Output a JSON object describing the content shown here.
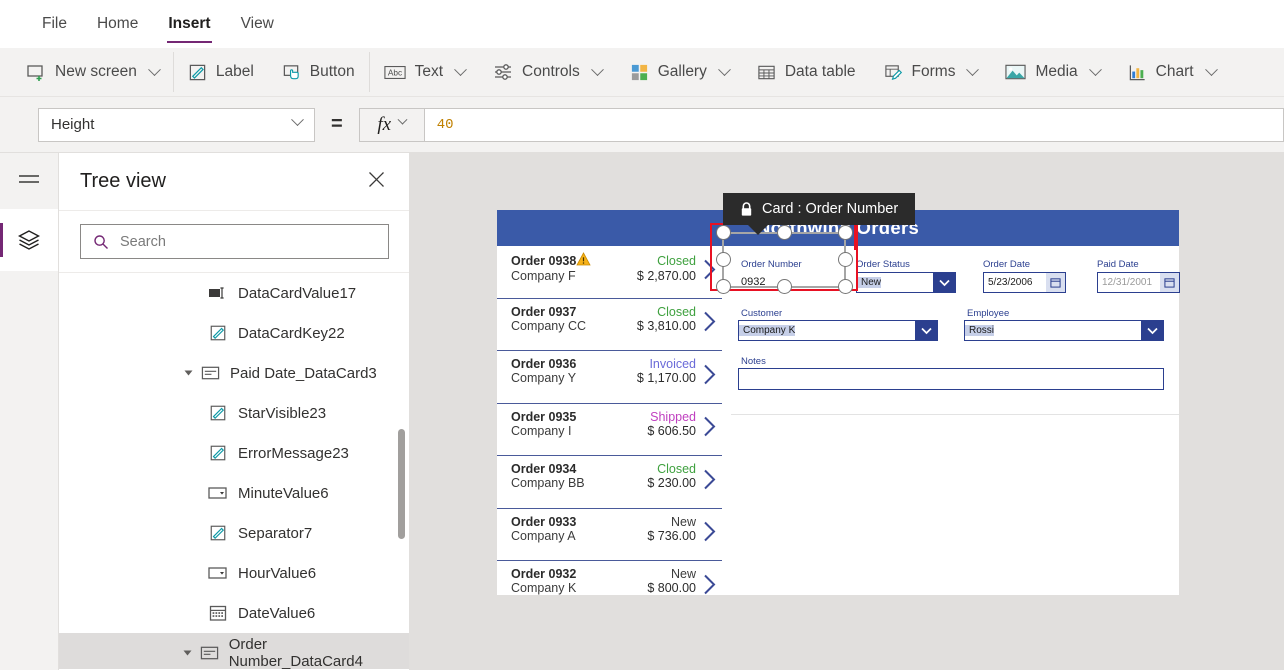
{
  "menu": {
    "items": [
      {
        "label": "File",
        "active": false
      },
      {
        "label": "Home",
        "active": false
      },
      {
        "label": "Insert",
        "active": true
      },
      {
        "label": "View",
        "active": false
      }
    ]
  },
  "ribbon": {
    "items": [
      {
        "label": "New screen",
        "icon": "new-screen-icon",
        "caret": true
      },
      {
        "label": "Label",
        "icon": "label-icon",
        "caret": false
      },
      {
        "label": "Button",
        "icon": "button-icon",
        "caret": false
      },
      {
        "label": "Text",
        "icon": "text-abc-icon",
        "caret": true
      },
      {
        "label": "Controls",
        "icon": "controls-sliders-icon",
        "caret": true
      },
      {
        "label": "Gallery",
        "icon": "gallery-squares-icon",
        "caret": true
      },
      {
        "label": "Data table",
        "icon": "data-table-icon",
        "caret": false
      },
      {
        "label": "Forms",
        "icon": "forms-icon",
        "caret": true
      },
      {
        "label": "Media",
        "icon": "media-image-icon",
        "caret": true
      },
      {
        "label": "Chart",
        "icon": "chart-bars-icon",
        "caret": true
      }
    ]
  },
  "property_bar": {
    "selected_property": "Height",
    "equals": "=",
    "fx_label": "fx",
    "formula_value": "40"
  },
  "tree_panel": {
    "title": "Tree view",
    "close_label": "✕",
    "search_placeholder": "Search",
    "search_value": "",
    "items": [
      {
        "label": "DataCardValue17",
        "icon": "text-input-icon",
        "indent": 3,
        "expander": false,
        "selected": false
      },
      {
        "label": "DataCardKey22",
        "icon": "label-pencil-icon",
        "indent": 3,
        "expander": false,
        "selected": false
      },
      {
        "label": "Paid Date_DataCard3",
        "icon": "datacard-icon",
        "indent": 2,
        "expander": true,
        "selected": false
      },
      {
        "label": "StarVisible23",
        "icon": "label-pencil-icon",
        "indent": 3,
        "expander": false,
        "selected": false
      },
      {
        "label": "ErrorMessage23",
        "icon": "label-pencil-icon",
        "indent": 3,
        "expander": false,
        "selected": false
      },
      {
        "label": "MinuteValue6",
        "icon": "dropdown-icon",
        "indent": 3,
        "expander": false,
        "selected": false
      },
      {
        "label": "Separator7",
        "icon": "label-pencil-icon",
        "indent": 3,
        "expander": false,
        "selected": false
      },
      {
        "label": "HourValue6",
        "icon": "dropdown-icon",
        "indent": 3,
        "expander": false,
        "selected": false
      },
      {
        "label": "DateValue6",
        "icon": "calendar-icon",
        "indent": 3,
        "expander": false,
        "selected": false
      },
      {
        "label": "Order Number_DataCard4",
        "icon": "datacard-icon",
        "indent": 2,
        "expander": true,
        "selected": true
      }
    ]
  },
  "canvas": {
    "app_title": "Northwind Orders",
    "tooltip": {
      "text": "Card : Order Number",
      "icon": "lock-icon"
    },
    "gallery": {
      "items": [
        {
          "order": "Order 0938",
          "company": "Company F",
          "status": "Closed",
          "status_color": "#3fa13f",
          "amount": "$ 2,870.00",
          "warning": true
        },
        {
          "order": "Order 0937",
          "company": "Company CC",
          "status": "Closed",
          "status_color": "#3fa13f",
          "amount": "$ 3,810.00",
          "warning": false
        },
        {
          "order": "Order 0936",
          "company": "Company Y",
          "status": "Invoiced",
          "status_color": "#6a6ad8",
          "amount": "$ 1,170.00",
          "warning": false
        },
        {
          "order": "Order 0935",
          "company": "Company I",
          "status": "Shipped",
          "status_color": "#c040c0",
          "amount": "$ 606.50",
          "warning": false
        },
        {
          "order": "Order 0934",
          "company": "Company BB",
          "status": "Closed",
          "status_color": "#3fa13f",
          "amount": "$ 230.00",
          "warning": false
        },
        {
          "order": "Order 0933",
          "company": "Company A",
          "status": "New",
          "status_color": "#3b3b3b",
          "amount": "$ 736.00",
          "warning": false
        },
        {
          "order": "Order 0932",
          "company": "Company K",
          "status": "New",
          "status_color": "#3b3b3b",
          "amount": "$ 800.00",
          "warning": false
        }
      ]
    },
    "form": {
      "fields": [
        {
          "label": "Order Number",
          "value": "0932",
          "type": "text-plain"
        },
        {
          "label": "Order Status",
          "value": "New",
          "type": "dropdown"
        },
        {
          "label": "Order Date",
          "value": "5/23/2006",
          "type": "date"
        },
        {
          "label": "Paid Date",
          "value": "12/31/2001",
          "type": "date-muted"
        },
        {
          "label": "Customer",
          "value": "Company K",
          "type": "dropdown"
        },
        {
          "label": "Employee",
          "value": "Rossi",
          "type": "dropdown"
        },
        {
          "label": "Notes",
          "value": "",
          "type": "textarea"
        }
      ]
    }
  },
  "colors": {
    "accent_purple": "#742774",
    "app_header_blue": "#3a5aa8",
    "selection_red": "#e81123",
    "formula_orange": "#c08000",
    "form_navy": "#2b3f8f"
  }
}
